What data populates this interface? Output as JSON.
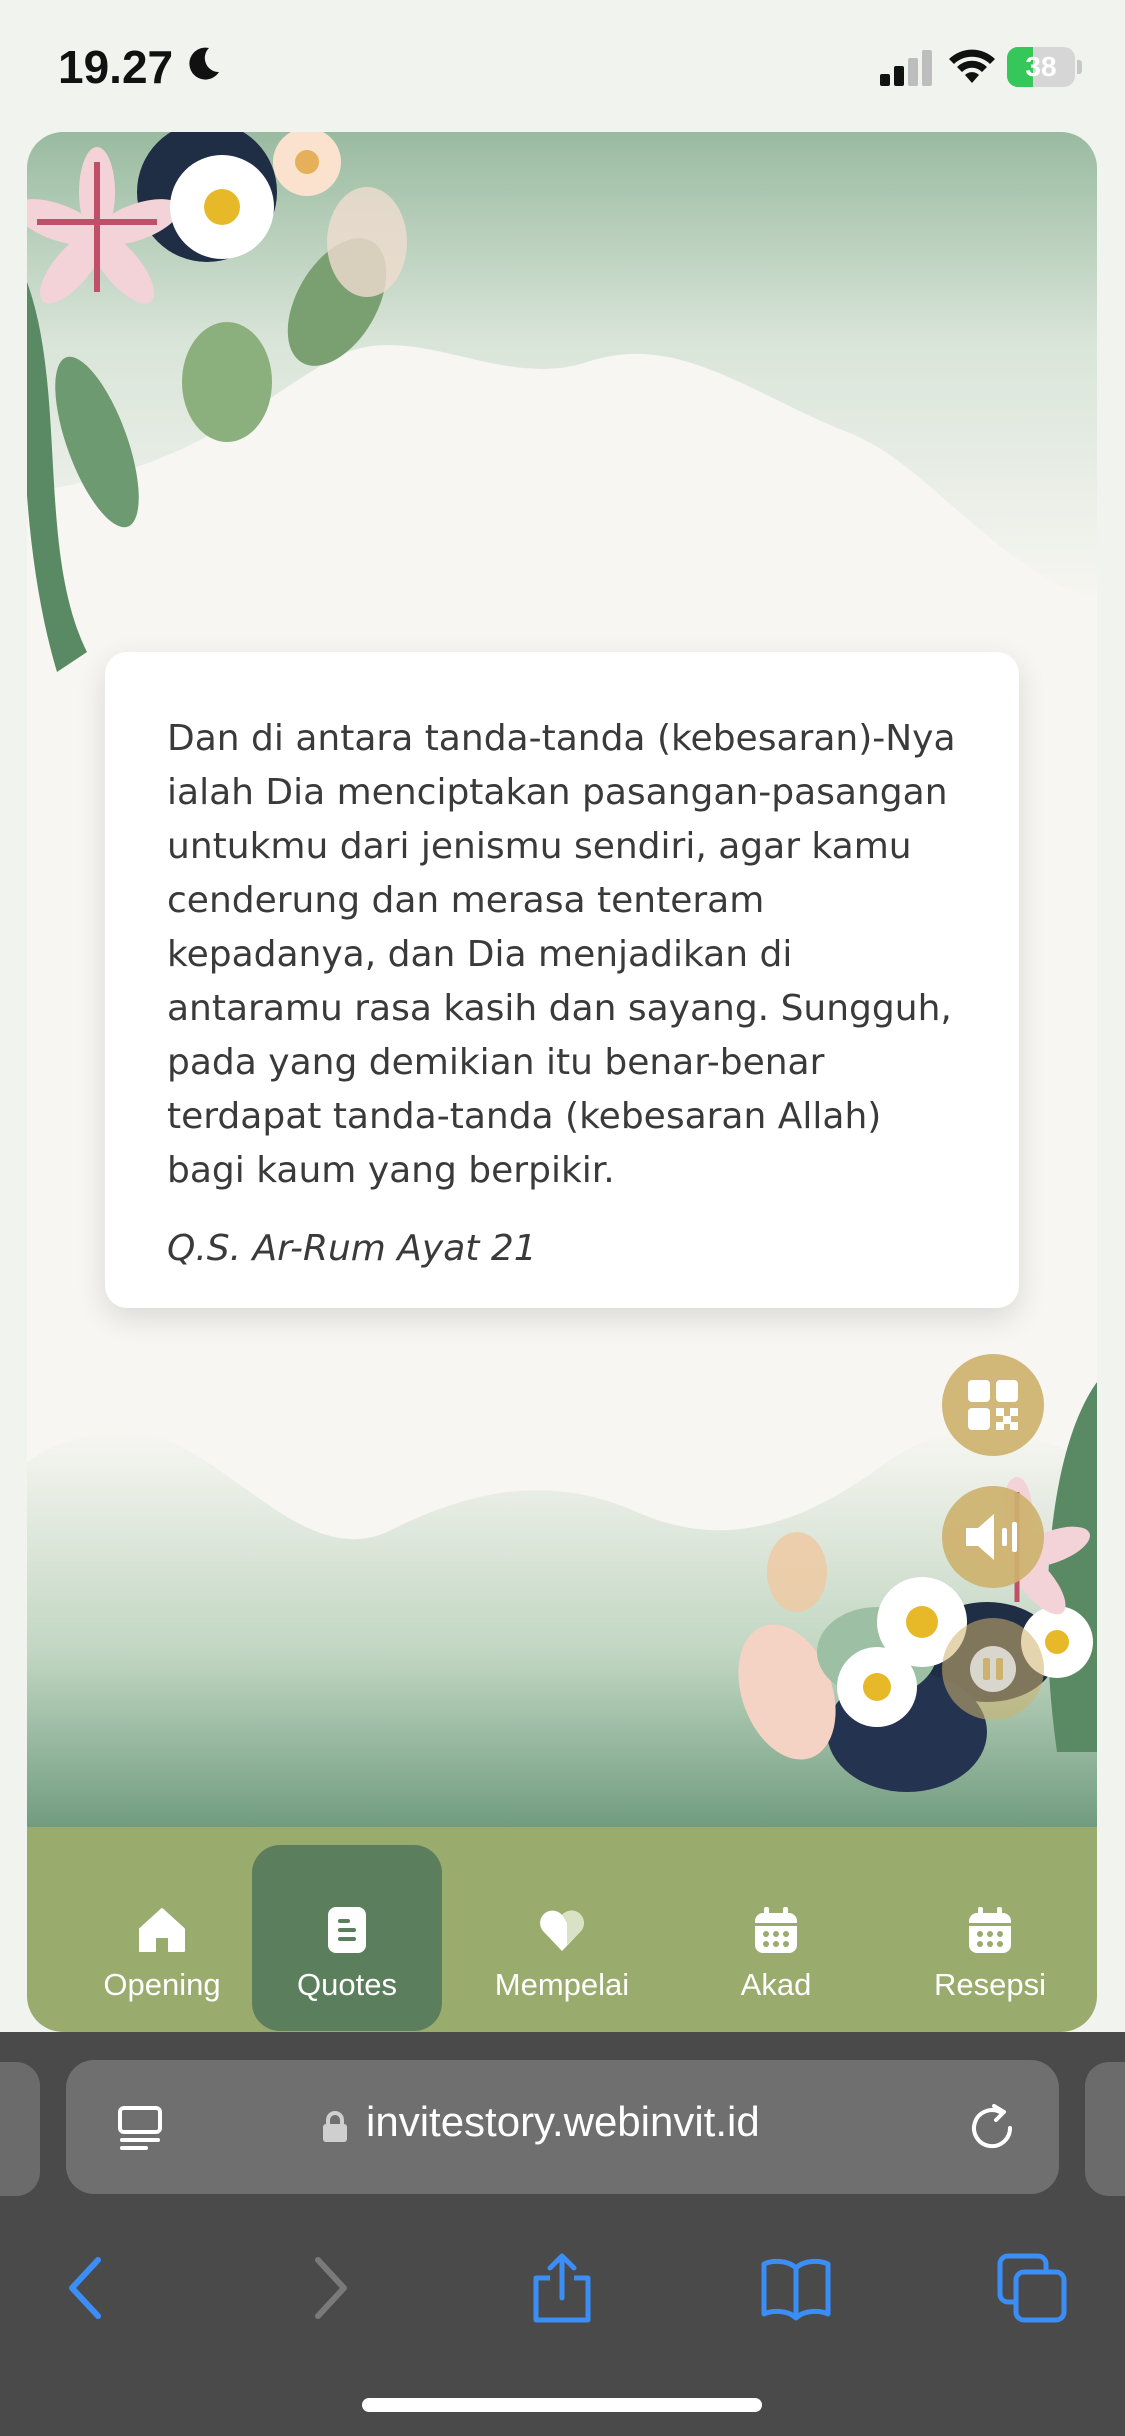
{
  "status": {
    "time": "19.27",
    "battery": "38",
    "battery_level": 0.38
  },
  "quote": {
    "text": "Dan di antara tanda-tanda (kebesaran)-Nya ialah Dia menciptakan pasangan-pasangan untukmu dari jenismu sendiri, agar kamu cenderung dan merasa tenteram kepadanya, dan Dia menjadikan di antaramu rasa kasih dan sayang. Sungguh, pada yang demikian itu benar-benar terdapat tanda-tanda (kebesaran Allah) bagi kaum yang berpikir.",
    "source": "Q.S. Ar-Rum Ayat 21"
  },
  "floating_buttons": [
    {
      "icon": "qr-code-icon"
    },
    {
      "icon": "speaker-icon"
    },
    {
      "icon": "pause-icon"
    }
  ],
  "nav": {
    "active": "Quotes",
    "items": [
      {
        "label": "Opening",
        "icon": "home-icon"
      },
      {
        "label": "Quotes",
        "icon": "document-icon"
      },
      {
        "label": "Mempelai",
        "icon": "heart-icon"
      },
      {
        "label": "Akad",
        "icon": "calendar-icon"
      },
      {
        "label": "Resepsi",
        "icon": "calendar-icon"
      }
    ]
  },
  "browser": {
    "url": "invitestory.webinvit.id"
  },
  "colors": {
    "nav_bg": "#9aab6e",
    "nav_active": "#5b7f5c",
    "fab": "#cdb26e",
    "safari_blue": "#3b8ef5"
  }
}
